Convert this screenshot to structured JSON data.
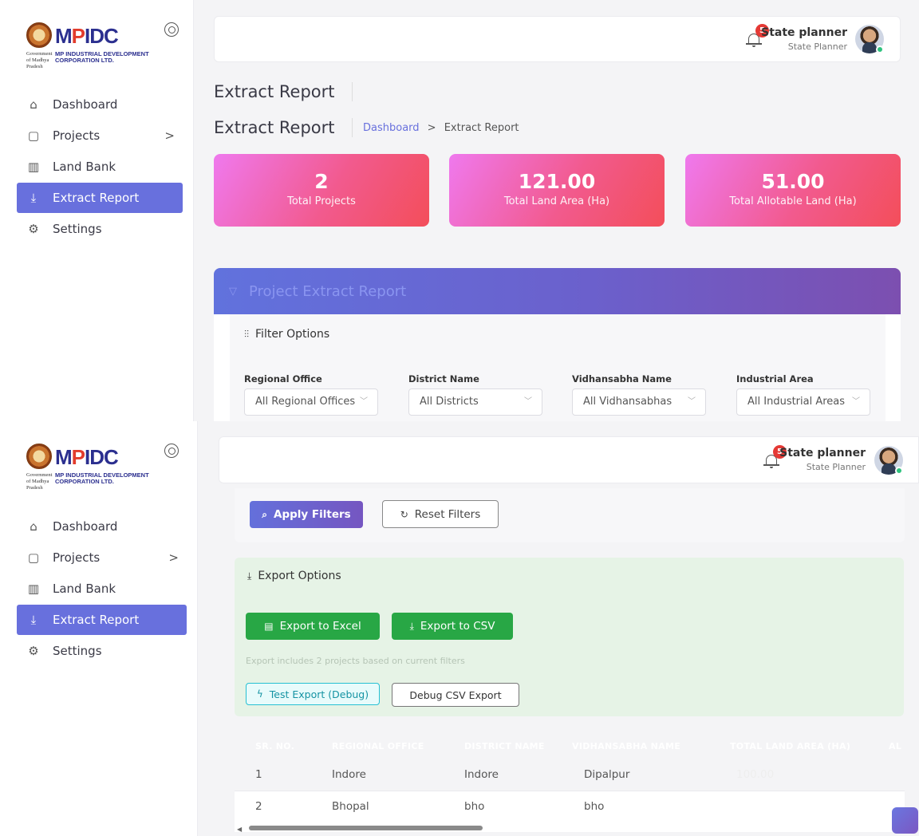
{
  "brand": {
    "mark_left": "M",
    "mark_accent": "P",
    "mark_right": "IDC",
    "gov_line": "Government of Madhya Pradesh",
    "corp_line1": "MP INDUSTRIAL DEVELOPMENT",
    "corp_line2": "CORPORATION LTD."
  },
  "sidebar": {
    "items": [
      {
        "label": "Dashboard",
        "icon": "home-icon"
      },
      {
        "label": "Projects",
        "icon": "clipboard-icon",
        "chevron": ">"
      },
      {
        "label": "Land Bank",
        "icon": "map-icon"
      },
      {
        "label": "Extract Report",
        "icon": "download-icon",
        "active": true
      },
      {
        "label": "Settings",
        "icon": "gear-icon"
      }
    ]
  },
  "header": {
    "notification_count": "5",
    "user_name": "State planner",
    "user_role": "State Planner"
  },
  "page": {
    "title": "Extract Report",
    "breadcrumb_home": "Dashboard",
    "breadcrumb_sep": ">",
    "breadcrumb_current": "Extract Report"
  },
  "stats": [
    {
      "value": "2",
      "label": "Total Projects"
    },
    {
      "value": "121.00",
      "label": "Total Land Area (Ha)"
    },
    {
      "value": "51.00",
      "label": "Total Allotable Land (Ha)"
    }
  ],
  "report_card": {
    "title": "Project Extract Report",
    "filter_title": "Filter Options",
    "filters": [
      {
        "label": "Regional Office",
        "value": "All Regional Offices"
      },
      {
        "label": "District Name",
        "value": "All Districts"
      },
      {
        "label": "Vidhansabha Name",
        "value": "All Vidhansabhas"
      },
      {
        "label": "Industrial Area",
        "value": "All Industrial Areas"
      }
    ],
    "apply_label": "Apply Filters",
    "reset_label": "Reset Filters"
  },
  "export": {
    "title": "Export Options",
    "excel_label": "Export to Excel",
    "csv_label": "Export to CSV",
    "note": "Export includes 2 projects based on current filters",
    "test_label": "Test Export (Debug)",
    "debug_label": "Debug CSV Export"
  },
  "table": {
    "columns": [
      "SR. NO.",
      "REGIONAL OFFICE",
      "DISTRICT NAME",
      "VIDHANSABHA NAME",
      "TOTAL LAND AREA (HA)",
      "AL"
    ],
    "rows": [
      [
        "1",
        "Indore",
        "Indore",
        "Dipalpur",
        "100.00"
      ],
      [
        "2",
        "Bhopal",
        "bho",
        "bho",
        ""
      ]
    ]
  },
  "colors": {
    "accent": "#6870dd",
    "stat_gradient_start": "#ef79ee",
    "stat_gradient_end": "#f34e5a",
    "export_green": "#28a745",
    "notification_red": "#e53935"
  }
}
